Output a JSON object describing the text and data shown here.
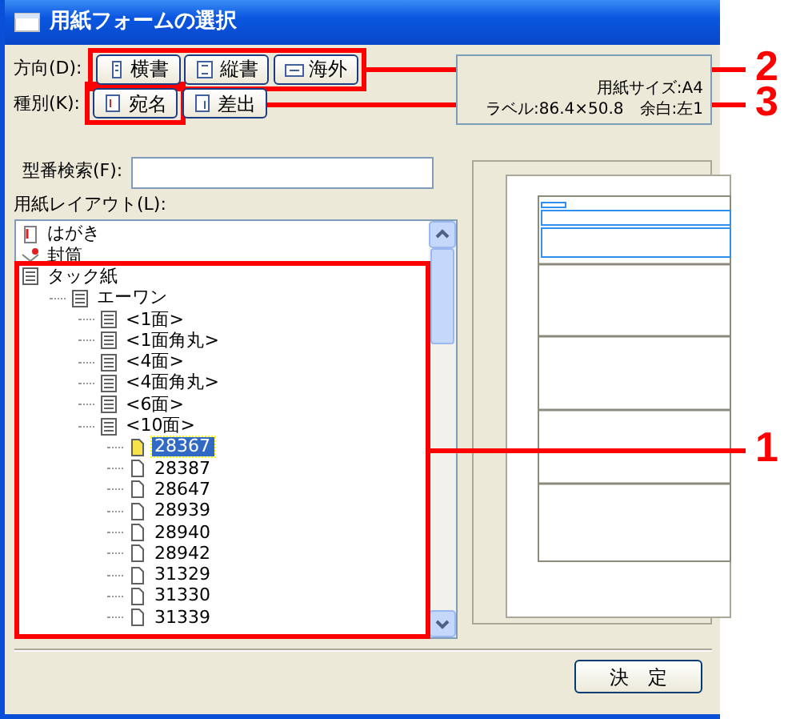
{
  "window": {
    "title": "用紙フォームの選択"
  },
  "direction": {
    "label": "方向(D):",
    "buttons": [
      {
        "label": "横書",
        "kind": "landscape"
      },
      {
        "label": "縦書",
        "kind": "portrait"
      },
      {
        "label": "海外",
        "kind": "overseas"
      }
    ]
  },
  "type": {
    "label": "種別(K):",
    "buttons": [
      {
        "label": "宛名",
        "kind": "address"
      },
      {
        "label": "差出",
        "kind": "sender"
      }
    ]
  },
  "info": {
    "lines": [
      "用紙サイズ:A4",
      "ラベル:86.4×50.8　余白:左1"
    ]
  },
  "search": {
    "label": "型番検索(F):"
  },
  "layout": {
    "label": "用紙レイアウト(L):"
  },
  "tree": [
    {
      "label": "はがき",
      "kind": "postcard",
      "selected": false
    },
    {
      "label": "封筒",
      "kind": "envelope",
      "selected": false
    },
    {
      "label": "タック紙",
      "kind": "sheet",
      "selected": false,
      "children": [
        {
          "label": "エーワン",
          "kind": "sheet",
          "selected": false,
          "children": [
            {
              "label": "<1面>",
              "kind": "sheet",
              "selected": false
            },
            {
              "label": "<1面角丸>",
              "kind": "sheet",
              "selected": false
            },
            {
              "label": "<4面>",
              "kind": "sheet",
              "selected": false
            },
            {
              "label": "<4面角丸>",
              "kind": "sheet",
              "selected": false
            },
            {
              "label": "<6面>",
              "kind": "sheet",
              "selected": false
            },
            {
              "label": "<10面>",
              "kind": "sheet",
              "selected": false,
              "children": [
                {
                  "label": "28367",
                  "kind": "document",
                  "selected": true
                },
                {
                  "label": "28387",
                  "kind": "document",
                  "selected": false
                },
                {
                  "label": "28647",
                  "kind": "document",
                  "selected": false
                },
                {
                  "label": "28939",
                  "kind": "document",
                  "selected": false
                },
                {
                  "label": "28940",
                  "kind": "document",
                  "selected": false
                },
                {
                  "label": "28942",
                  "kind": "document",
                  "selected": false
                },
                {
                  "label": "31329",
                  "kind": "document",
                  "selected": false
                },
                {
                  "label": "31330",
                  "kind": "document",
                  "selected": false
                },
                {
                  "label": "31339",
                  "kind": "document",
                  "selected": false
                }
              ]
            }
          ]
        }
      ]
    }
  ],
  "ok_button": "決　定",
  "callouts": [
    {
      "number": "2"
    },
    {
      "number": "3"
    },
    {
      "number": "1"
    }
  ]
}
